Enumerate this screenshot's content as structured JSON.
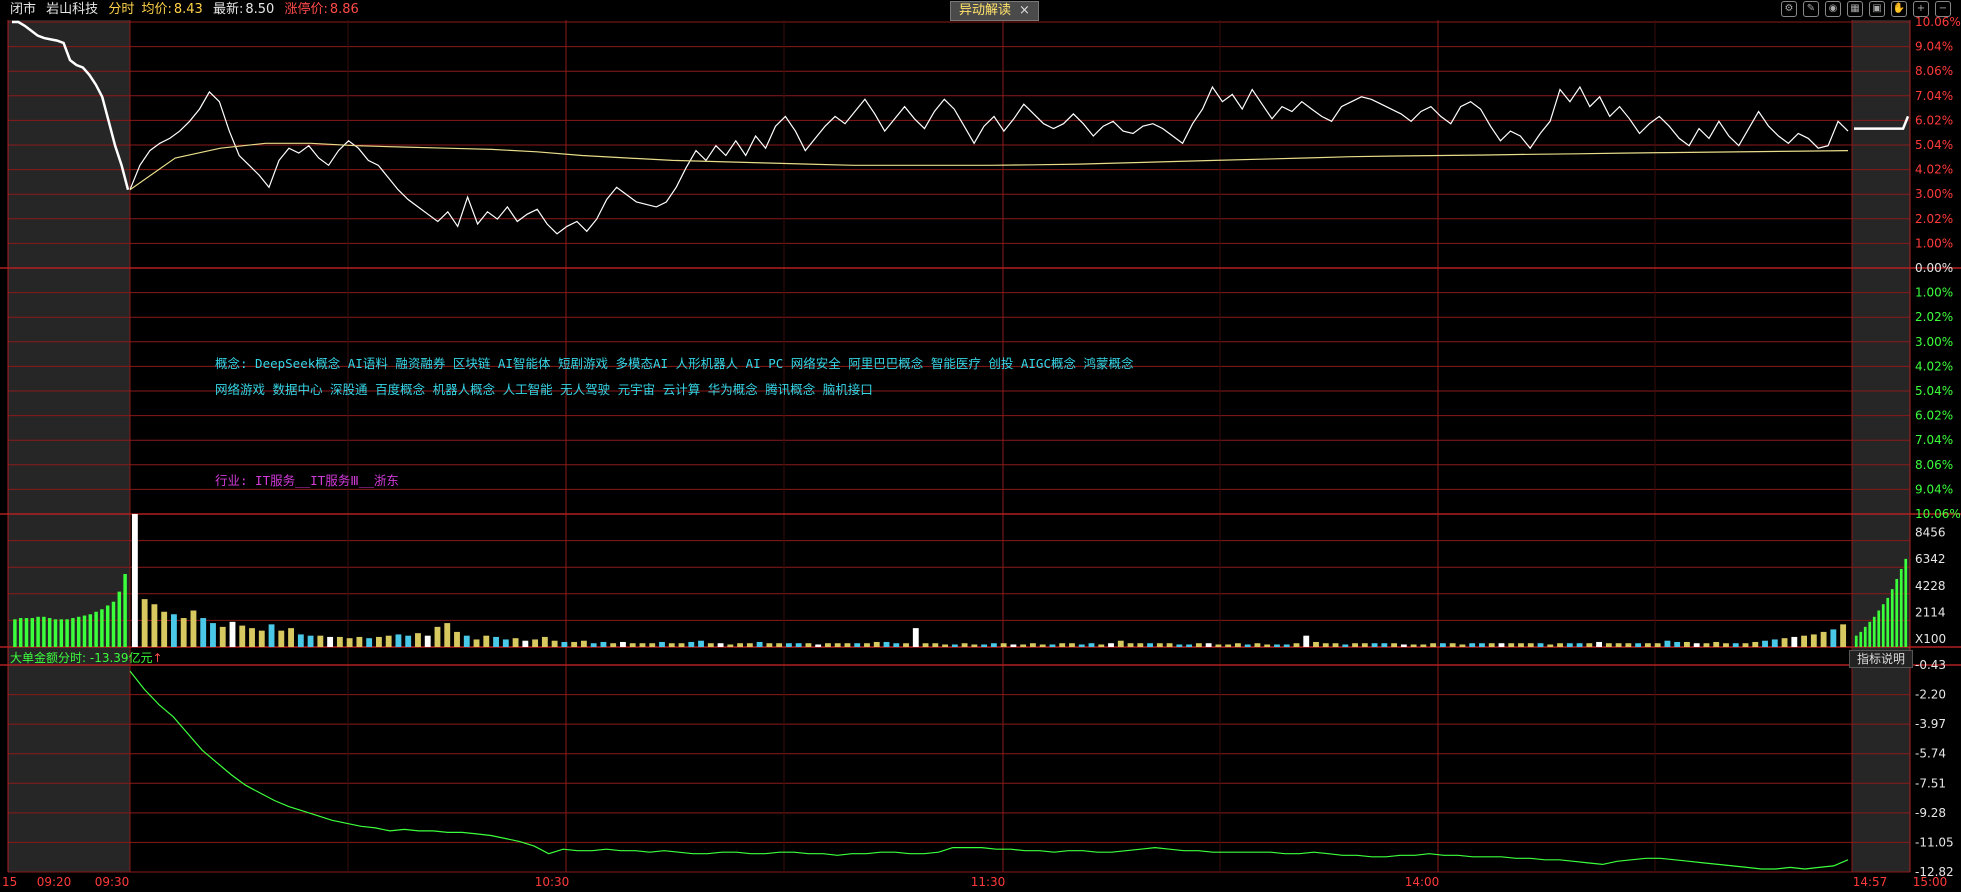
{
  "header": {
    "market_state": "闭市",
    "stock_name": "岩山科技",
    "mode": "分时",
    "avg_label": "均价:",
    "avg_value": "8.43",
    "last_label": "最新:",
    "last_value": "8.50",
    "limit_label": "涨停价:",
    "limit_value": "8.86",
    "popup_button": "异动解读",
    "popup_close": "×",
    "toolbar_icons": [
      "gear-icon",
      "compass-icon",
      "eye-icon",
      "cube-icon",
      "lock-icon",
      "hand-icon",
      "zoom-in-icon",
      "zoom-out-icon"
    ]
  },
  "concepts": {
    "line1": "概念: DeepSeek概念 AI语料 融资融券 区块链 AI智能体 短剧游戏 多模态AI 人形机器人 AI PC 网络安全 阿里巴巴概念 智能医疗 创投 AIGC概念 鸿蒙概念",
    "line2": "网络游戏 数据中心 深股通 百度概念 机器人概念 人工智能 无人驾驶 元宇宙 云计算 华为概念 腾讯概念 脑机接口",
    "industry": "行业: IT服务__IT服务Ⅲ__浙东"
  },
  "indicator": {
    "label": "大单金额分时: -13.39亿元",
    "arrow": "↑",
    "legend_button": "指标说明"
  },
  "colors": {
    "price_line": "#ffffff",
    "avg_line": "#e8dc8a",
    "grid": "#8a1a1a",
    "preopen_bg": "#262626",
    "up": "#ff3a3a",
    "down": "#3cff3c",
    "volume_yellow": "#d8c860",
    "volume_cyan": "#4ac8e8",
    "indicator_line": "#3cff3c"
  },
  "chart_data": [
    {
      "type": "line",
      "ylim_pct": [
        0,
        10.06
      ],
      "right_ticks": [
        "10.06%",
        "9.04%",
        "8.06%",
        "7.04%",
        "6.02%",
        "5.04%",
        "4.02%",
        "3.00%",
        "2.02%",
        "1.00%",
        "0.00%"
      ],
      "lower_ticks": [
        "1.00%",
        "2.02%",
        "3.00%",
        "4.02%",
        "5.04%",
        "6.02%",
        "7.04%",
        "8.06%",
        "9.04%",
        "10.06%"
      ],
      "x_ticks": [
        "15",
        "09:20",
        "09:30",
        "10:30",
        "11:30",
        "14:00",
        "14:57",
        "15:00"
      ],
      "preopen_price_pct": [
        10.06,
        10.06,
        9.9,
        9.7,
        9.5,
        9.4,
        9.35,
        9.3,
        9.2,
        8.5,
        8.3,
        8.2,
        7.9,
        7.5,
        7.0,
        6.0,
        5.0,
        4.2,
        3.2
      ],
      "series": [
        {
          "values_pct": [
            3.2,
            4.2,
            4.8,
            5.1,
            5.3,
            5.6,
            6.0,
            6.5,
            7.2,
            6.8,
            5.6,
            4.6,
            4.2,
            3.8,
            3.3,
            4.4,
            4.9,
            4.7,
            5.0,
            4.5,
            4.2,
            4.8,
            5.2,
            4.9,
            4.4,
            4.2,
            3.7,
            3.2,
            2.8,
            2.5,
            2.2,
            1.9,
            2.3,
            1.7,
            2.9,
            1.8,
            2.3,
            2.0,
            2.5,
            1.9,
            2.2,
            2.4,
            1.8,
            1.4,
            1.7,
            1.9,
            1.5,
            2.0,
            2.8,
            3.3,
            3.0,
            2.7,
            2.6,
            2.5,
            2.7,
            3.3,
            4.1,
            4.8,
            4.4,
            5.0,
            4.6,
            5.2,
            4.6,
            5.4,
            4.9,
            5.8,
            6.2,
            5.6,
            4.8,
            5.3,
            5.8,
            6.2,
            5.9,
            6.4,
            6.9,
            6.3,
            5.6,
            6.1,
            6.6,
            6.1,
            5.7,
            6.4,
            6.9,
            6.5,
            5.8,
            5.1,
            5.8,
            6.2,
            5.6,
            6.1,
            6.7,
            6.3,
            5.9,
            5.7,
            5.9,
            6.3,
            5.9,
            5.4,
            5.8,
            6.0,
            5.6,
            5.5,
            5.8,
            5.9,
            5.7,
            5.4,
            5.1,
            5.9,
            6.5,
            7.4,
            6.8,
            7.1,
            6.5,
            7.3,
            6.7,
            6.1,
            6.6,
            6.4,
            6.8,
            6.5,
            6.2,
            6.0,
            6.6,
            6.8,
            7.0,
            6.9,
            6.7,
            6.5,
            6.3,
            6.0,
            6.4,
            6.6,
            6.2,
            5.9,
            6.6,
            6.8,
            6.5,
            5.8,
            5.2,
            5.6,
            5.4,
            4.9,
            5.5,
            6.0,
            7.3,
            6.8,
            7.4,
            6.6,
            7.0,
            6.2,
            6.6,
            6.1,
            5.5,
            5.9,
            6.2,
            5.8,
            5.3,
            5.0,
            5.7,
            5.3,
            6.0,
            5.4,
            5.0,
            5.7,
            6.4,
            5.8,
            5.4,
            5.1,
            5.5,
            5.3,
            4.9,
            5.0,
            6.0,
            5.6
          ],
          "avg_pct": [
            3.2,
            4.5,
            4.9,
            5.1,
            5.1,
            5.0,
            4.95,
            4.9,
            4.85,
            4.75,
            4.6,
            4.5,
            4.4,
            4.35,
            4.3,
            4.25,
            4.2,
            4.2,
            4.2,
            4.2,
            4.22,
            4.25,
            4.3,
            4.35,
            4.4,
            4.45,
            4.5,
            4.55,
            4.58,
            4.6,
            4.62,
            4.65,
            4.67,
            4.7,
            4.72,
            4.74,
            4.76,
            4.78,
            4.8
          ]
        }
      ],
      "postclose_price_pct": [
        5.7,
        5.7,
        5.7,
        5.7,
        5.7,
        5.7,
        5.7,
        5.7,
        5.7,
        5.7,
        5.7,
        6.2
      ]
    },
    {
      "type": "bar",
      "y_ticks": [
        "8456",
        "6342",
        "4228",
        "2114",
        "X100"
      ],
      "ylim": [
        0,
        10570
      ],
      "preopen_volume_values": [
        2200,
        2300,
        2300,
        2300,
        2400,
        2400,
        2300,
        2200,
        2200,
        2200,
        2300,
        2400,
        2500,
        2600,
        2800,
        3000,
        3300,
        3600,
        4400,
        5800
      ],
      "volume_values": [
        10570,
        3800,
        3400,
        2800,
        2600,
        2300,
        2900,
        2300,
        1900,
        1600,
        2000,
        1700,
        1500,
        1300,
        1800,
        1300,
        1500,
        1000,
        900,
        900,
        800,
        800,
        700,
        800,
        700,
        800,
        900,
        1000,
        900,
        1100,
        900,
        1600,
        1900,
        1200,
        900,
        600,
        900,
        800,
        600,
        700,
        500,
        600,
        800,
        500,
        400,
        400,
        500,
        300,
        400,
        300,
        400,
        300,
        300,
        300,
        400,
        300,
        300,
        400,
        500,
        300,
        300,
        200,
        300,
        300,
        400,
        300,
        300,
        300,
        300,
        300,
        200,
        300,
        300,
        300,
        300,
        300,
        400,
        400,
        300,
        300,
        1500,
        300,
        300,
        200,
        200,
        300,
        200,
        200,
        300,
        300,
        200,
        200,
        300,
        200,
        200,
        300,
        300,
        200,
        300,
        200,
        300,
        500,
        300,
        300,
        300,
        300,
        300,
        200,
        200,
        300,
        300,
        200,
        200,
        300,
        200,
        300,
        200,
        200,
        200,
        300,
        900,
        400,
        300,
        300,
        200,
        300,
        300,
        300,
        300,
        300,
        200,
        200,
        200,
        300,
        300,
        300,
        200,
        300,
        300,
        300,
        300,
        300,
        300,
        300,
        300,
        200,
        300,
        300,
        300,
        300,
        400,
        300,
        300,
        300,
        300,
        300,
        300,
        500,
        400,
        400,
        300,
        300,
        400,
        300,
        300,
        300,
        400,
        500,
        600,
        700,
        800,
        900,
        1000,
        1200,
        1400,
        1800
      ],
      "postclose_volume_values": [
        900,
        1200,
        1600,
        2000,
        2400,
        2900,
        3400,
        3900,
        4600,
        5400,
        6200,
        7000
      ],
      "bar_colors": [
        "#ffffff",
        "#d8c860",
        "#d8c860",
        "#d8c860",
        "#4ac8e8",
        "#d8c860",
        "#d8c860",
        "#4ac8e8",
        "#4ac8e8",
        "#d8c860"
      ]
    },
    {
      "type": "line",
      "y_ticks": [
        "-0.43",
        "-2.20",
        "-3.97",
        "-5.74",
        "-7.51",
        "-9.28",
        "-11.05",
        "-12.82"
      ],
      "ylim": [
        -13.6,
        0.0
      ],
      "series": [
        {
          "name": "大单金额分时",
          "values": [
            -0.4,
            -1.6,
            -2.6,
            -3.4,
            -4.5,
            -5.6,
            -6.4,
            -7.2,
            -7.9,
            -8.4,
            -8.9,
            -9.3,
            -9.6,
            -9.9,
            -10.2,
            -10.4,
            -10.6,
            -10.7,
            -10.9,
            -10.8,
            -10.9,
            -10.9,
            -11.0,
            -11.0,
            -11.1,
            -11.2,
            -11.4,
            -11.6,
            -11.9,
            -12.4,
            -12.1,
            -12.2,
            -12.2,
            -12.1,
            -12.2,
            -12.2,
            -12.3,
            -12.2,
            -12.3,
            -12.4,
            -12.4,
            -12.3,
            -12.3,
            -12.4,
            -12.4,
            -12.3,
            -12.3,
            -12.4,
            -12.4,
            -12.5,
            -12.4,
            -12.4,
            -12.3,
            -12.3,
            -12.4,
            -12.4,
            -12.3,
            -12.0,
            -12.0,
            -12.0,
            -12.1,
            -12.1,
            -12.2,
            -12.2,
            -12.3,
            -12.2,
            -12.2,
            -12.3,
            -12.3,
            -12.2,
            -12.1,
            -12.0,
            -12.1,
            -12.2,
            -12.2,
            -12.3,
            -12.3,
            -12.3,
            -12.3,
            -12.3,
            -12.4,
            -12.4,
            -12.3,
            -12.4,
            -12.5,
            -12.5,
            -12.6,
            -12.6,
            -12.5,
            -12.5,
            -12.4,
            -12.5,
            -12.5,
            -12.6,
            -12.6,
            -12.6,
            -12.7,
            -12.7,
            -12.8,
            -12.8,
            -12.9,
            -13.0,
            -13.1,
            -12.9,
            -12.8,
            -12.7,
            -12.7,
            -12.8,
            -12.9,
            -13.0,
            -13.1,
            -13.2,
            -13.3,
            -13.4,
            -13.4,
            -13.3,
            -13.4,
            -13.3,
            -13.2,
            -12.8
          ]
        }
      ]
    }
  ]
}
